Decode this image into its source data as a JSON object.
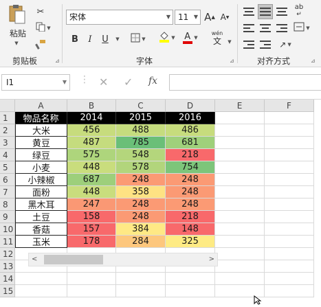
{
  "ribbon": {
    "clipboard": {
      "label": "剪贴板",
      "paste_label": "粘贴"
    },
    "font": {
      "label": "字体",
      "font_name": "宋体",
      "font_size": "11",
      "bold": "B",
      "italic": "I",
      "underline": "U",
      "grow": "A",
      "shrink": "A",
      "phonetic": "wén",
      "phonetic_char": "文"
    },
    "alignment": {
      "label": "对齐方式",
      "phonetic": "ab"
    }
  },
  "formula_bar": {
    "name_box": "I1",
    "fx": "fx",
    "content": ""
  },
  "columns": [
    "A",
    "B",
    "C",
    "D",
    "E",
    "F"
  ],
  "rows": [
    "1",
    "2",
    "3",
    "4",
    "5",
    "6",
    "7",
    "8",
    "9",
    "10",
    "11",
    "12",
    "13",
    "14",
    "15"
  ],
  "table": {
    "headers": [
      "物品名称",
      "2014",
      "2015",
      "2016"
    ],
    "rows": [
      {
        "name": "大米",
        "values": [
          "456",
          "488",
          "486"
        ]
      },
      {
        "name": "黄豆",
        "values": [
          "487",
          "785",
          "681"
        ]
      },
      {
        "name": "绿豆",
        "values": [
          "575",
          "548",
          "218"
        ]
      },
      {
        "name": "小麦",
        "values": [
          "448",
          "578",
          "754"
        ]
      },
      {
        "name": "小辣椒",
        "values": [
          "687",
          "248",
          "248"
        ]
      },
      {
        "name": "面粉",
        "values": [
          "448",
          "358",
          "248"
        ]
      },
      {
        "name": "黑木耳",
        "values": [
          "247",
          "248",
          "248"
        ]
      },
      {
        "name": "土豆",
        "values": [
          "158",
          "248",
          "218"
        ]
      },
      {
        "name": "香菇",
        "values": [
          "157",
          "384",
          "148"
        ]
      },
      {
        "name": "玉米",
        "values": [
          "178",
          "284",
          "325"
        ]
      }
    ],
    "fills": [
      [
        "#c7dc7d",
        "#c5dc7e",
        "#c7dc7d"
      ],
      [
        "#c5dc7e",
        "#6abf78",
        "#9fd07b"
      ],
      [
        "#aed57c",
        "#b4d67c",
        "#f8696b"
      ],
      [
        "#c9dd7d",
        "#b2d57c",
        "#7dc57a"
      ],
      [
        "#9dcf7b",
        "#fb9a74",
        "#fb9a74"
      ],
      [
        "#c9dd7d",
        "#fee283",
        "#fb9a74"
      ],
      [
        "#fa9874",
        "#fb9a74",
        "#fb9a74"
      ],
      [
        "#f8696b",
        "#fb9a74",
        "#f8696b"
      ],
      [
        "#f8696b",
        "#ffe985",
        "#f8696b"
      ],
      [
        "#f8696b",
        "#fdc77d",
        "#feeb84"
      ]
    ]
  }
}
